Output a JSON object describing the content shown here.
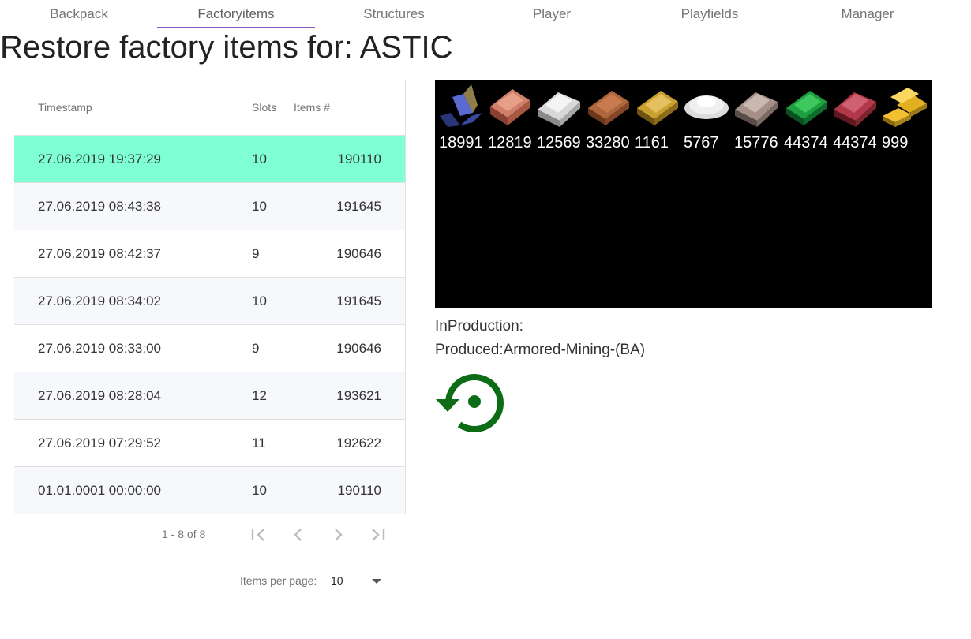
{
  "tabs": [
    {
      "label": "Backpack"
    },
    {
      "label": "Factoryitems",
      "active": true
    },
    {
      "label": "Structures"
    },
    {
      "label": "Player"
    },
    {
      "label": "Playfields"
    },
    {
      "label": "Manager"
    }
  ],
  "title": "Restore factory items for: ASTIC",
  "table": {
    "headers": {
      "timestamp": "Timestamp",
      "slots": "Slots",
      "items": "Items #"
    },
    "rows": [
      {
        "timestamp": "27.06.2019 19:37:29",
        "slots": "10",
        "items": "190110"
      },
      {
        "timestamp": "27.06.2019 08:43:38",
        "slots": "10",
        "items": "191645"
      },
      {
        "timestamp": "27.06.2019 08:42:37",
        "slots": "9",
        "items": "190646"
      },
      {
        "timestamp": "27.06.2019 08:34:02",
        "slots": "10",
        "items": "191645"
      },
      {
        "timestamp": "27.06.2019 08:33:00",
        "slots": "9",
        "items": "190646"
      },
      {
        "timestamp": "27.06.2019 08:28:04",
        "slots": "12",
        "items": "193621"
      },
      {
        "timestamp": "27.06.2019 07:29:52",
        "slots": "11",
        "items": "192622"
      },
      {
        "timestamp": "01.01.0001 00:00:00",
        "slots": "10",
        "items": "190110"
      }
    ],
    "selected_row": 0
  },
  "paginator": {
    "range": "1 - 8 of 8",
    "items_per_page_label": "Items per page:",
    "items_per_page_value": "10",
    "buttons": [
      "first-page-icon",
      "previous-page-icon",
      "next-page-icon",
      "last-page-icon"
    ]
  },
  "items": [
    {
      "icon": "iron-ingot-icon",
      "count": "18991",
      "color": "#3a4aa0"
    },
    {
      "icon": "copper-ingot-icon",
      "count": "12819",
      "color": "#c06a50"
    },
    {
      "icon": "silver-ingot-icon",
      "count": "12569",
      "color": "#c8c8c8"
    },
    {
      "icon": "cobalt-ingot-icon",
      "count": "33280",
      "color": "#b0663c"
    },
    {
      "icon": "gold-bar-icon",
      "count": "1161",
      "color": "#c8a030"
    },
    {
      "icon": "silicon-powder-icon",
      "count": "5767",
      "color": "#e8e8e8"
    },
    {
      "icon": "neodymium-ingot-icon",
      "count": "15776",
      "color": "#a49088"
    },
    {
      "icon": "erestrum-ingot-icon",
      "count": "44374",
      "color": "#1ea040"
    },
    {
      "icon": "zascosium-ingot-icon",
      "count": "44374",
      "color": "#b03848"
    },
    {
      "icon": "gold-ingot-icon",
      "count": "999",
      "color": "#e0b020"
    }
  ],
  "production": {
    "in_production": "InProduction:",
    "produced": "Produced:Armored-Mining-(BA)"
  },
  "restore_icon": "restore-icon",
  "colors": {
    "accent": "#7e57c2",
    "selected_row": "#7fffd4",
    "restore": "#0c6d16"
  }
}
